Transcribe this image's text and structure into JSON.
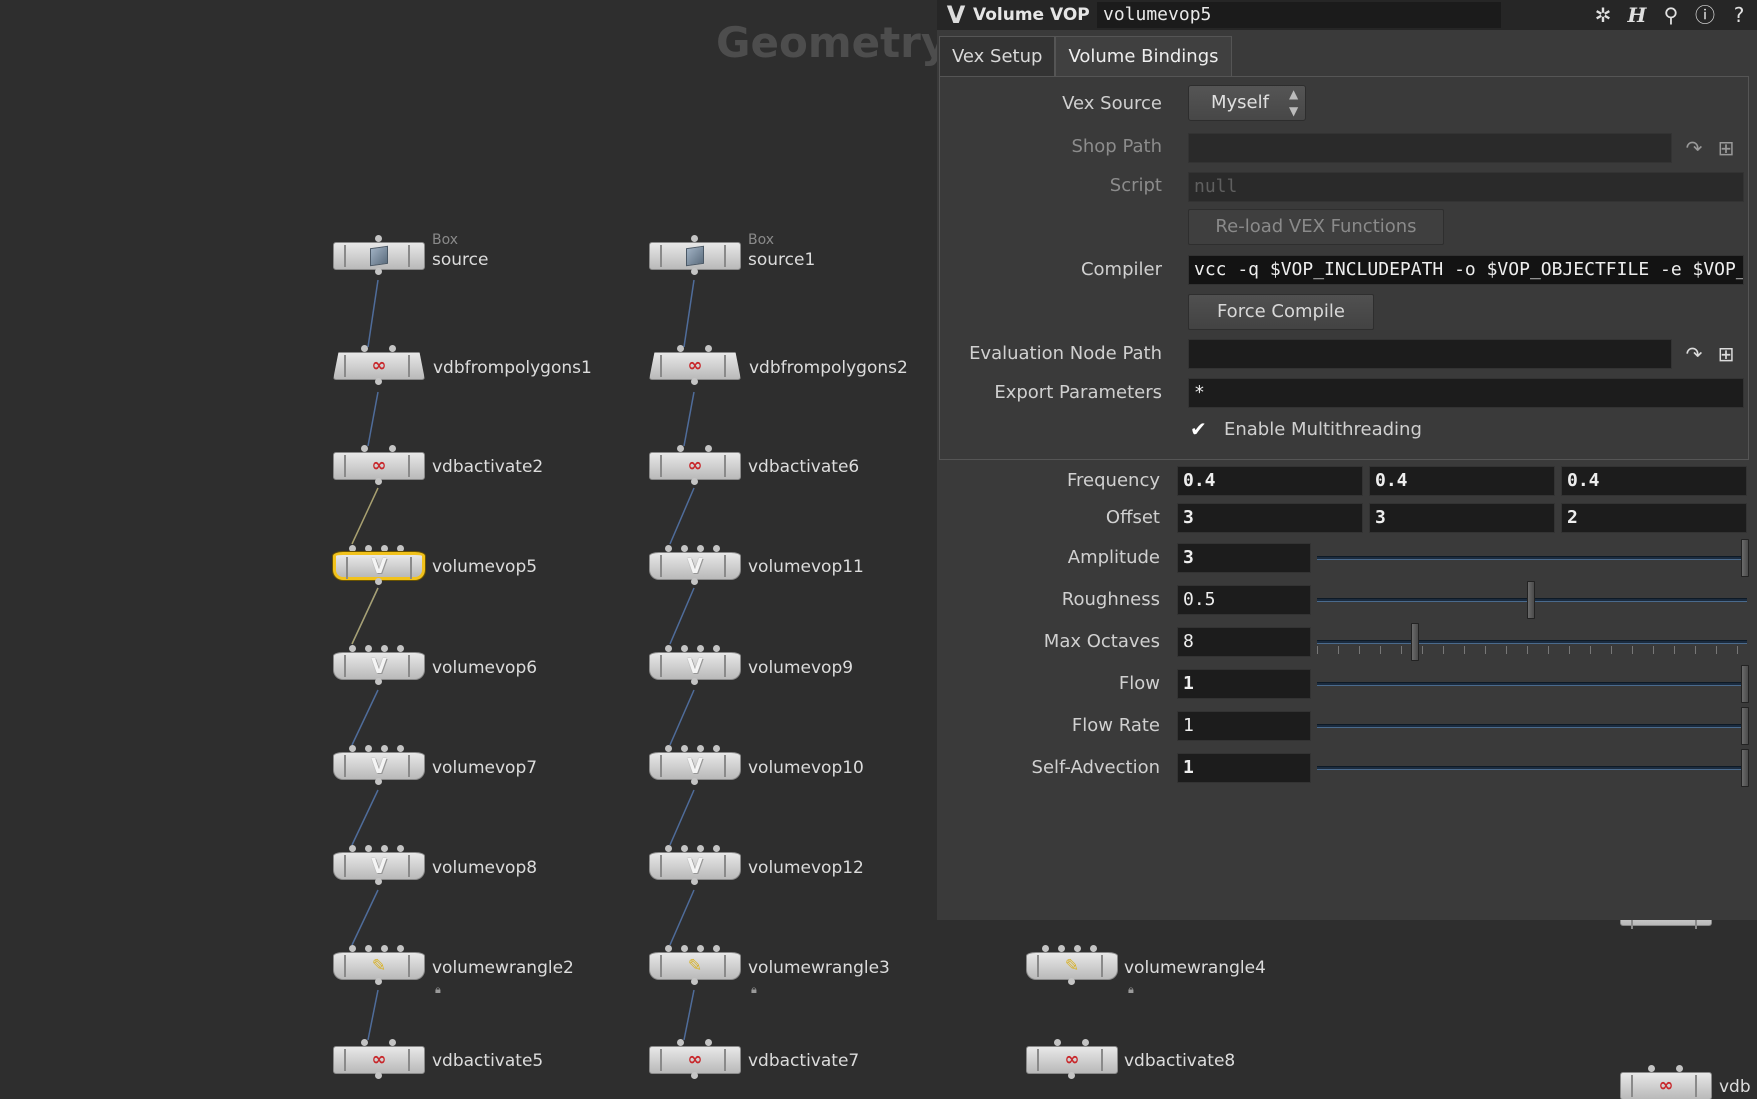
{
  "network": {
    "title": "Geometry",
    "nodes": [
      {
        "type_label": "Box",
        "name": "source"
      },
      {
        "type_label": "Box",
        "name": "source1"
      },
      {
        "name": "vdbfrompolygons1"
      },
      {
        "name": "vdbfrompolygons2"
      },
      {
        "name": "vdbactivate2"
      },
      {
        "name": "vdbactivate6"
      },
      {
        "name": "volumevop5"
      },
      {
        "name": "volumevop11"
      },
      {
        "name": "volumevop6"
      },
      {
        "name": "volumevop9"
      },
      {
        "name": "volumevop7"
      },
      {
        "name": "volumevop10"
      },
      {
        "name": "volumevop8"
      },
      {
        "name": "volumevop12"
      },
      {
        "name": "volumewrangle2"
      },
      {
        "name": "volumewrangle3"
      },
      {
        "name": "volumewrangle4"
      },
      {
        "name": "vdbactivate5"
      },
      {
        "name": "vdbactivate7"
      },
      {
        "name": "vdbactivate8"
      },
      {
        "name": "vdb"
      }
    ]
  },
  "params": {
    "node_type": "Volume VOP",
    "node_name": "volumevop5",
    "title_icons": [
      "gear-icon",
      "houdini-help-icon",
      "search-icon",
      "info-icon",
      "help-icon"
    ],
    "tabs": [
      "Vex Setup",
      "Volume Bindings"
    ],
    "vex_source_label": "Vex Source",
    "vex_source_value": "Myself",
    "shop_path_label": "Shop Path",
    "shop_path_value": "",
    "script_label": "Script",
    "script_value": "null",
    "reload_button": "Re-load VEX Functions",
    "compiler_label": "Compiler",
    "compiler_value": "vcc -q $VOP_INCLUDEPATH -o $VOP_OBJECTFILE -e $VOP_ERRORFILE $VOP_SOURCEFILE",
    "force_compile_button": "Force Compile",
    "eval_node_path_label": "Evaluation Node Path",
    "eval_node_path_value": "",
    "export_params_label": "Export Parameters",
    "export_params_value": "*",
    "multithreading_label": "Enable Multithreading",
    "multithreading_checked": true,
    "frequency_label": "Frequency",
    "frequency": [
      "0.4",
      "0.4",
      "0.4"
    ],
    "offset_label": "Offset",
    "offset": [
      "3",
      "3",
      "2"
    ],
    "amplitude_label": "Amplitude",
    "amplitude": "3",
    "roughness_label": "Roughness",
    "roughness": "0.5",
    "max_octaves_label": "Max Octaves",
    "max_octaves": "8",
    "flow_label": "Flow",
    "flow": "1",
    "flow_rate_label": "Flow Rate",
    "flow_rate": "1",
    "self_advection_label": "Self-Advection",
    "self_advection": "1"
  }
}
